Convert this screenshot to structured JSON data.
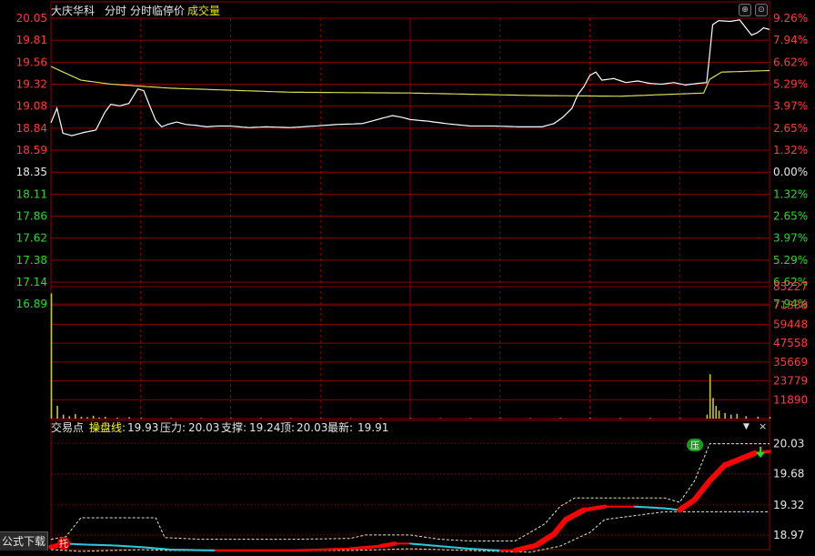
{
  "header": {
    "stock_name": "大庆华科",
    "tab_minute": "分时",
    "tab_limit": "分时临停价",
    "tab_volume": "成交量"
  },
  "indicator_bar": {
    "name": "交易点",
    "line_label": "操盘线:",
    "line_value": "19.93",
    "pressure_label": "压力:",
    "pressure_value": "20.03",
    "support_label": "支撑:",
    "support_value": "19.24",
    "top_label": "顶:",
    "top_value": "20.03",
    "latest_label": "最新:",
    "latest_value": "19.91"
  },
  "badges": {
    "support": "托",
    "pressure": "压"
  },
  "formula_button": "公式下载",
  "colors": {
    "background": "#000000",
    "grid": "#8b0000",
    "price_line": "#ffffff",
    "avg_line": "#d9d95a",
    "up_text": "#ff3c3c",
    "down_text": "#2ed82e",
    "flat_text": "#e6e6e6",
    "volume_bar": "#c8c832",
    "ind_rise": "#ff0000",
    "ind_fall": "#2ec8d8",
    "band": "#e6e6b4",
    "label_yellow": "#ffff00"
  },
  "chart_data": [
    {
      "type": "line",
      "title": "大庆华科 分时",
      "y_ticks_left": [
        "20.05",
        "19.81",
        "19.56",
        "19.32",
        "19.08",
        "18.84",
        "18.59",
        "18.35",
        "18.11",
        "17.86",
        "17.62",
        "17.38",
        "17.14",
        "16.89"
      ],
      "y_ticks_right": [
        "9.26%",
        "7.94%",
        "6.62%",
        "5.29%",
        "3.97%",
        "2.65%",
        "1.32%",
        "0.00%",
        "1.32%",
        "2.65%",
        "3.97%",
        "5.29%",
        "6.62%",
        "7.94%"
      ],
      "prev_close": 18.35,
      "ylim": [
        16.77,
        20.05
      ],
      "x_points": 241,
      "series": [
        {
          "name": "price",
          "points": [
            [
              0,
              18.75
            ],
            [
              2,
              18.93
            ],
            [
              4,
              18.62
            ],
            [
              7,
              18.59
            ],
            [
              11,
              18.63
            ],
            [
              15,
              18.66
            ],
            [
              18,
              18.88
            ],
            [
              20,
              18.98
            ],
            [
              23,
              18.96
            ],
            [
              26,
              18.99
            ],
            [
              29,
              19.17
            ],
            [
              31,
              19.15
            ],
            [
              33,
              18.96
            ],
            [
              35,
              18.78
            ],
            [
              37,
              18.7
            ],
            [
              39,
              18.73
            ],
            [
              42,
              18.76
            ],
            [
              45,
              18.73
            ],
            [
              48,
              18.72
            ],
            [
              52,
              18.7
            ],
            [
              56,
              18.71
            ],
            [
              60,
              18.71
            ],
            [
              66,
              18.69
            ],
            [
              72,
              18.7
            ],
            [
              80,
              18.69
            ],
            [
              88,
              18.71
            ],
            [
              96,
              18.73
            ],
            [
              104,
              18.74
            ],
            [
              110,
              18.8
            ],
            [
              114,
              18.84
            ],
            [
              117,
              18.82
            ],
            [
              120,
              18.79
            ],
            [
              126,
              18.77
            ],
            [
              132,
              18.74
            ],
            [
              140,
              18.71
            ],
            [
              148,
              18.71
            ],
            [
              156,
              18.7
            ],
            [
              164,
              18.7
            ],
            [
              168,
              18.74
            ],
            [
              171,
              18.82
            ],
            [
              174,
              18.93
            ],
            [
              176,
              19.1
            ],
            [
              178,
              19.2
            ],
            [
              180,
              19.34
            ],
            [
              182,
              19.38
            ],
            [
              184,
              19.28
            ],
            [
              188,
              19.3
            ],
            [
              192,
              19.25
            ],
            [
              196,
              19.27
            ],
            [
              200,
              19.24
            ],
            [
              204,
              19.23
            ],
            [
              208,
              19.25
            ],
            [
              212,
              19.22
            ],
            [
              216,
              19.24
            ],
            [
              219,
              19.25
            ],
            [
              220,
              19.6
            ],
            [
              221,
              19.97
            ],
            [
              223,
              20.02
            ],
            [
              227,
              20.01
            ],
            [
              230,
              20.03
            ],
            [
              234,
              19.84
            ],
            [
              236,
              19.87
            ],
            [
              238,
              19.93
            ],
            [
              240,
              19.91
            ]
          ]
        },
        {
          "name": "avg",
          "points": [
            [
              0,
              19.45
            ],
            [
              10,
              19.28
            ],
            [
              20,
              19.23
            ],
            [
              40,
              19.18
            ],
            [
              80,
              19.13
            ],
            [
              120,
              19.12
            ],
            [
              160,
              19.09
            ],
            [
              190,
              19.08
            ],
            [
              218,
              19.12
            ],
            [
              220,
              19.29
            ],
            [
              224,
              19.38
            ],
            [
              240,
              19.4
            ]
          ]
        }
      ]
    },
    {
      "type": "bar",
      "title": "成交量",
      "y_ticks": [
        "83227",
        "71338",
        "59448",
        "47558",
        "35669",
        "23779",
        "11890"
      ],
      "ylim": [
        0,
        83227
      ],
      "bars": [
        [
          0,
          79000
        ],
        [
          2,
          8000
        ],
        [
          4,
          2500
        ],
        [
          6,
          1500
        ],
        [
          8,
          2800
        ],
        [
          10,
          1200
        ],
        [
          12,
          900
        ],
        [
          14,
          1800
        ],
        [
          16,
          700
        ],
        [
          18,
          1100
        ],
        [
          22,
          600
        ],
        [
          26,
          900
        ],
        [
          30,
          500
        ],
        [
          40,
          400
        ],
        [
          50,
          350
        ],
        [
          60,
          300
        ],
        [
          70,
          350
        ],
        [
          80,
          300
        ],
        [
          90,
          280
        ],
        [
          100,
          250
        ],
        [
          110,
          320
        ],
        [
          120,
          300
        ],
        [
          130,
          280
        ],
        [
          140,
          260
        ],
        [
          150,
          300
        ],
        [
          160,
          280
        ],
        [
          170,
          350
        ],
        [
          180,
          400
        ],
        [
          190,
          380
        ],
        [
          200,
          350
        ],
        [
          210,
          300
        ],
        [
          219,
          2500
        ],
        [
          220,
          28000
        ],
        [
          221,
          13000
        ],
        [
          222,
          8000
        ],
        [
          223,
          5000
        ],
        [
          225,
          3500
        ],
        [
          227,
          2500
        ],
        [
          229,
          3000
        ],
        [
          232,
          1500
        ],
        [
          236,
          1200
        ],
        [
          240,
          1000
        ]
      ]
    },
    {
      "type": "line",
      "title": "交易点",
      "y_ticks": [
        "20.03",
        "19.68",
        "19.32",
        "18.97"
      ],
      "ylim": [
        18.8,
        20.1
      ],
      "series": [
        {
          "name": "操盘线",
          "points": [
            [
              0,
              18.83
            ],
            [
              5,
              18.87
            ],
            [
              10,
              18.86
            ],
            [
              20,
              18.85
            ],
            [
              30,
              18.83
            ],
            [
              40,
              18.8
            ],
            [
              55,
              18.79
            ],
            [
              70,
              18.79
            ],
            [
              80,
              18.79
            ],
            [
              90,
              18.8
            ],
            [
              100,
              18.81
            ],
            [
              110,
              18.84
            ],
            [
              115,
              18.87
            ],
            [
              120,
              18.87
            ],
            [
              130,
              18.84
            ],
            [
              140,
              18.81
            ],
            [
              150,
              18.79
            ],
            [
              155,
              18.79
            ],
            [
              162,
              18.85
            ],
            [
              168,
              18.98
            ],
            [
              172,
              19.15
            ],
            [
              178,
              19.26
            ],
            [
              185,
              19.3
            ],
            [
              195,
              19.3
            ],
            [
              205,
              19.28
            ],
            [
              210,
              19.26
            ],
            [
              215,
              19.38
            ],
            [
              220,
              19.6
            ],
            [
              225,
              19.78
            ],
            [
              230,
              19.85
            ],
            [
              235,
              19.92
            ],
            [
              240,
              19.94
            ]
          ]
        },
        {
          "name": "压力",
          "points": [
            [
              0,
              18.92
            ],
            [
              5,
              18.95
            ],
            [
              10,
              19.17
            ],
            [
              35,
              19.17
            ],
            [
              38,
              18.94
            ],
            [
              50,
              18.92
            ],
            [
              80,
              18.92
            ],
            [
              100,
              18.93
            ],
            [
              105,
              18.97
            ],
            [
              120,
              18.97
            ],
            [
              130,
              18.92
            ],
            [
              140,
              18.9
            ],
            [
              155,
              18.9
            ],
            [
              165,
              19.1
            ],
            [
              170,
              19.3
            ],
            [
              175,
              19.4
            ],
            [
              205,
              19.4
            ],
            [
              210,
              19.35
            ],
            [
              215,
              19.6
            ],
            [
              220,
              20.03
            ],
            [
              240,
              20.03
            ]
          ]
        },
        {
          "name": "支撑",
          "points": [
            [
              0,
              18.8
            ],
            [
              10,
              18.78
            ],
            [
              30,
              18.8
            ],
            [
              40,
              18.79
            ],
            [
              70,
              18.79
            ],
            [
              100,
              18.79
            ],
            [
              120,
              18.81
            ],
            [
              140,
              18.79
            ],
            [
              160,
              18.77
            ],
            [
              170,
              18.84
            ],
            [
              180,
              19.0
            ],
            [
              185,
              19.15
            ],
            [
              205,
              19.24
            ],
            [
              240,
              19.24
            ]
          ]
        }
      ]
    }
  ]
}
